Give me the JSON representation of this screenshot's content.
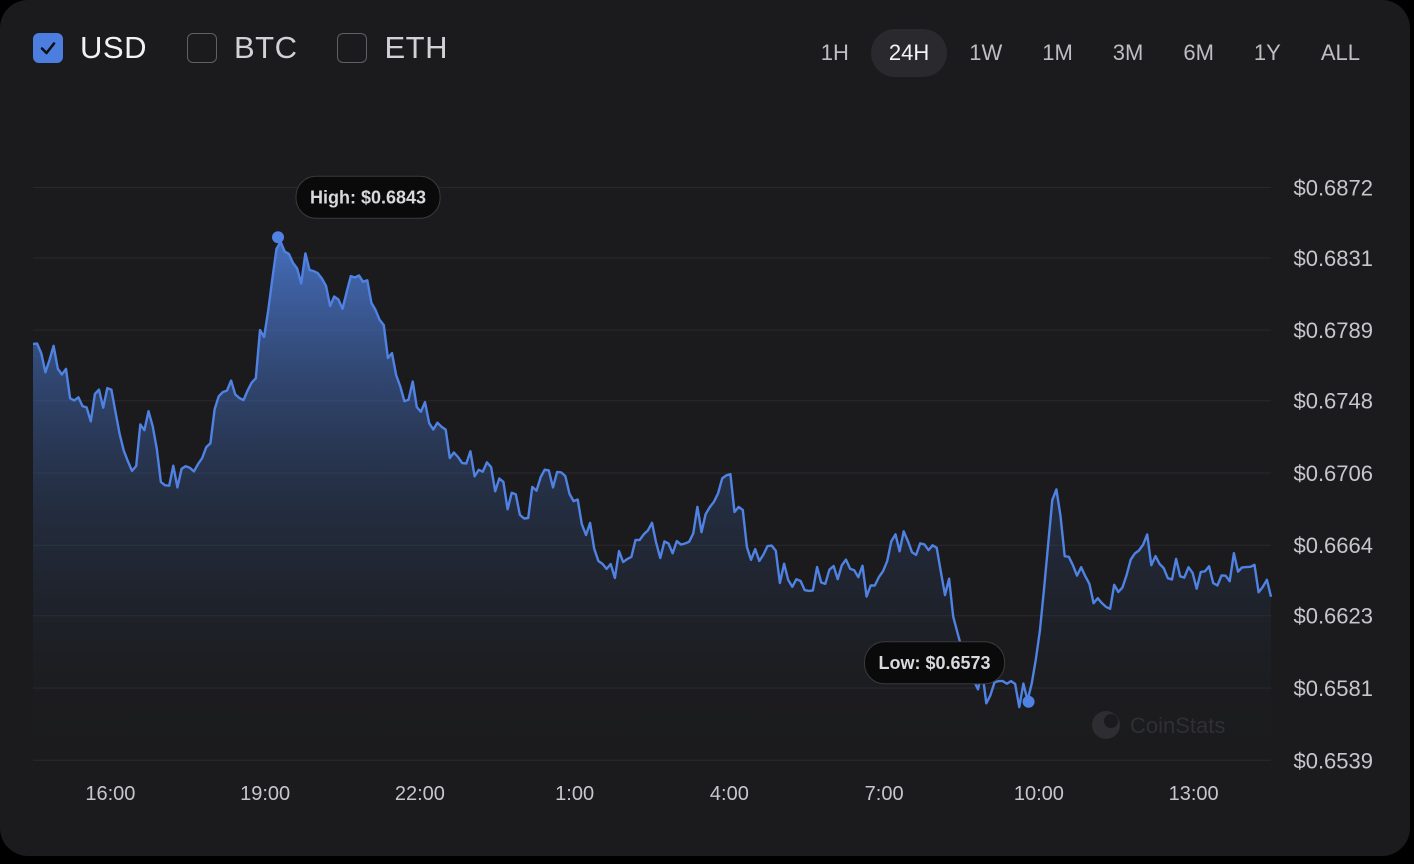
{
  "currencies": [
    {
      "label": "USD",
      "checked": true
    },
    {
      "label": "BTC",
      "checked": false
    },
    {
      "label": "ETH",
      "checked": false
    }
  ],
  "ranges": [
    {
      "label": "1H",
      "active": false
    },
    {
      "label": "24H",
      "active": true
    },
    {
      "label": "1W",
      "active": false
    },
    {
      "label": "1M",
      "active": false
    },
    {
      "label": "3M",
      "active": false
    },
    {
      "label": "6M",
      "active": false
    },
    {
      "label": "1Y",
      "active": false
    },
    {
      "label": "ALL",
      "active": false
    }
  ],
  "brand": "CoinStats",
  "colors": {
    "line": "#4f82e3",
    "background": "#1b1b1d",
    "accent": "#4c7ee0"
  },
  "chart_data": {
    "type": "area",
    "x_start_hour": 14.5,
    "x_end_hour": 38.5,
    "ylim": [
      0.65345,
      0.6885
    ],
    "y_ticks": [
      0.6872,
      0.6831,
      0.6789,
      0.6748,
      0.6706,
      0.6664,
      0.6623,
      0.6581,
      0.6539
    ],
    "y_tick_labels": [
      "$0.6872",
      "$0.6831",
      "$0.6789",
      "$0.6748",
      "$0.6706",
      "$0.6664",
      "$0.6623",
      "$0.6581",
      "$0.6539"
    ],
    "x_ticks": [
      16,
      19,
      22,
      25,
      28,
      31,
      34,
      37
    ],
    "x_tick_labels": [
      "16:00",
      "19:00",
      "22:00",
      "1:00",
      "4:00",
      "7:00",
      "10:00",
      "13:00"
    ],
    "grid": true,
    "high": {
      "label": "High: $0.6843",
      "value": 0.6843,
      "x": 19.25
    },
    "low": {
      "label": "Low: $0.6573",
      "value": 0.6573,
      "x": 33.8
    },
    "series": [
      {
        "x": [
          14.5,
          15.0,
          15.5,
          16.0,
          16.4,
          16.75,
          17.0,
          17.4,
          17.8,
          18.2,
          18.6,
          19.0,
          19.25,
          19.6,
          20.0,
          20.4,
          20.8,
          21.2,
          21.6,
          22.0,
          22.4,
          22.8,
          23.2,
          23.6,
          24.0,
          24.4,
          24.8,
          25.2,
          25.6,
          26.0,
          26.4,
          26.8,
          27.2,
          27.6,
          28.0,
          28.4,
          28.8,
          29.2,
          29.6,
          30.0,
          30.4,
          30.8,
          31.2,
          31.6,
          32.0,
          32.4,
          32.8,
          33.2,
          33.5,
          33.8,
          34.0,
          34.3,
          34.6,
          34.9,
          35.2,
          35.6,
          36.0,
          36.4,
          36.8,
          37.2,
          37.6,
          38.0,
          38.5
        ],
        "y": [
          0.6781,
          0.6766,
          0.6743,
          0.6757,
          0.6705,
          0.6743,
          0.6697,
          0.6709,
          0.6715,
          0.6755,
          0.6748,
          0.6787,
          0.6843,
          0.6825,
          0.6823,
          0.6806,
          0.6822,
          0.6797,
          0.6757,
          0.6742,
          0.6734,
          0.6712,
          0.6707,
          0.6702,
          0.6678,
          0.6708,
          0.6706,
          0.6671,
          0.665,
          0.6655,
          0.6673,
          0.6665,
          0.6665,
          0.6685,
          0.6708,
          0.6655,
          0.6665,
          0.664,
          0.6637,
          0.6652,
          0.665,
          0.6639,
          0.6671,
          0.6658,
          0.6665,
          0.6615,
          0.658,
          0.6585,
          0.6585,
          0.6573,
          0.6608,
          0.6703,
          0.6654,
          0.6646,
          0.663,
          0.6638,
          0.6665,
          0.6651,
          0.6645,
          0.6649,
          0.6646,
          0.6652,
          0.6634
        ]
      }
    ]
  }
}
